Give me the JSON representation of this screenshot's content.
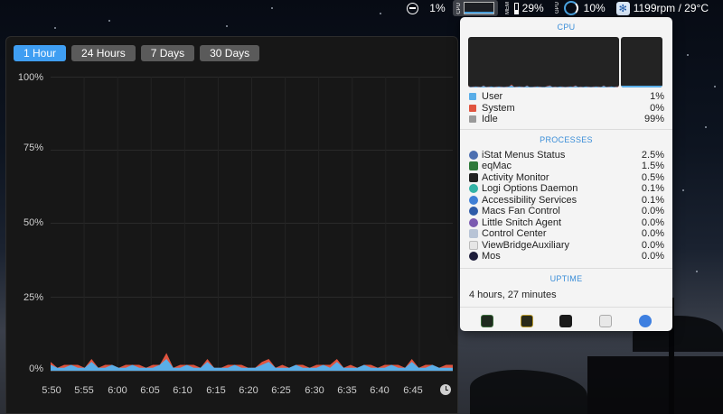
{
  "menubar": {
    "cpu_mini_label": "CPU",
    "percent_1": "1%",
    "memory_label": "MEM",
    "memory_value": "29%",
    "gpu_label": "GPU",
    "gpu_value": "10%",
    "fan_text": "1199rpm / 29°C"
  },
  "history": {
    "tabs": [
      {
        "label": "1 Hour",
        "active": true
      },
      {
        "label": "24 Hours",
        "active": false
      },
      {
        "label": "7 Days",
        "active": false
      },
      {
        "label": "30 Days",
        "active": false
      }
    ],
    "y_labels": [
      "100%",
      "75%",
      "50%",
      "25%",
      "0%"
    ],
    "x_labels": [
      "5:50",
      "5:55",
      "6:00",
      "6:05",
      "6:10",
      "6:15",
      "6:20",
      "6:25",
      "6:30",
      "6:35",
      "6:40",
      "6:45"
    ]
  },
  "chart_data": {
    "type": "area",
    "ylim": [
      0,
      100
    ],
    "series": [
      {
        "name": "User",
        "color": "#5aaee8",
        "values": [
          2,
          1,
          1,
          2,
          1,
          1,
          3,
          1,
          1,
          2,
          1,
          1,
          2,
          1,
          1,
          1,
          2,
          4,
          1,
          1,
          2,
          1,
          1,
          3,
          1,
          1,
          1,
          2,
          1,
          1,
          1,
          2,
          3,
          1,
          1,
          1,
          2,
          1,
          1,
          1,
          2,
          1,
          3,
          1,
          1,
          1,
          2,
          1,
          1,
          1,
          2,
          1,
          1,
          3,
          1,
          1,
          2,
          1,
          1,
          1
        ]
      },
      {
        "name": "System",
        "color": "#e0543f",
        "values": [
          1,
          0,
          1,
          0,
          1,
          0,
          1,
          0,
          1,
          0,
          0,
          1,
          0,
          1,
          0,
          1,
          0,
          2,
          0,
          1,
          0,
          1,
          0,
          1,
          0,
          0,
          1,
          0,
          1,
          0,
          0,
          1,
          1,
          0,
          1,
          0,
          0,
          1,
          0,
          1,
          0,
          1,
          1,
          0,
          1,
          0,
          0,
          1,
          0,
          1,
          0,
          1,
          0,
          1,
          0,
          1,
          0,
          0,
          1,
          1
        ]
      }
    ]
  },
  "dropdown": {
    "cpu_title": "CPU",
    "legend": [
      {
        "label": "User",
        "value": "1%",
        "color": "#5aaee8"
      },
      {
        "label": "System",
        "value": "0%",
        "color": "#e0543f"
      },
      {
        "label": "Idle",
        "value": "99%",
        "color": "#9a9a9a"
      }
    ],
    "processes_title": "PROCESSES",
    "processes": [
      {
        "name": "iStat Menus Status",
        "value": "2.5%",
        "color": "#4c6fb0"
      },
      {
        "name": "eqMac",
        "value": "1.5%",
        "color": "#2f7a3b"
      },
      {
        "name": "Activity Monitor",
        "value": "0.5%",
        "color": "#222222"
      },
      {
        "name": "Logi Options Daemon",
        "value": "0.1%",
        "color": "#33b3a6"
      },
      {
        "name": "Accessibility Services",
        "value": "0.1%",
        "color": "#3f7fd6"
      },
      {
        "name": "Macs Fan Control",
        "value": "0.0%",
        "color": "#2e5ba8"
      },
      {
        "name": "Little Snitch Agent",
        "value": "0.0%",
        "color": "#7a5ab0"
      },
      {
        "name": "Control Center",
        "value": "0.0%",
        "color": "#b8c4d6"
      },
      {
        "name": "ViewBridgeAuxiliary",
        "value": "0.0%",
        "color": "#d0d0d0"
      },
      {
        "name": "Mos",
        "value": "0.0%",
        "color": "#1d1d3a"
      }
    ],
    "uptime_title": "UPTIME",
    "uptime_value": "4 hours, 27 minutes"
  }
}
